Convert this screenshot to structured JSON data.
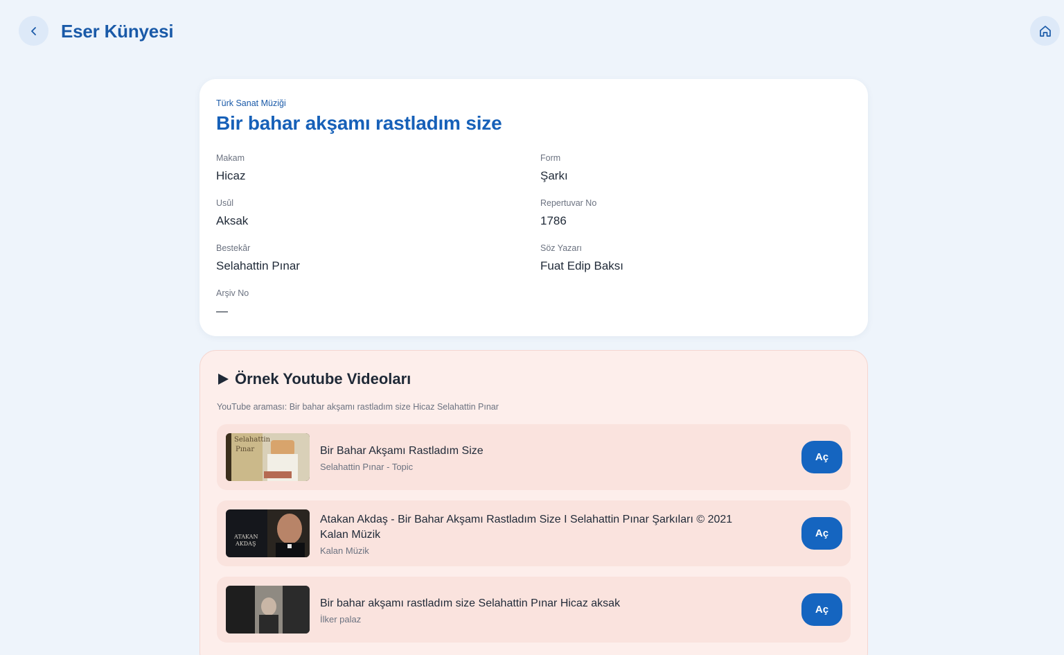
{
  "header": {
    "title": "Eser Künyesi",
    "back_icon": "chevron-left-icon",
    "home_icon": "home-icon"
  },
  "work": {
    "genre": "Türk Sanat Müziği",
    "title": "Bir bahar akşamı rastladım size",
    "fields": {
      "makam": {
        "label": "Makam",
        "value": "Hicaz"
      },
      "form": {
        "label": "Form",
        "value": "Şarkı"
      },
      "usul": {
        "label": "Usûl",
        "value": "Aksak"
      },
      "repertuvar": {
        "label": "Repertuvar No",
        "value": "1786"
      },
      "bestekar": {
        "label": "Bestekâr",
        "value": "Selahattin Pınar"
      },
      "soz_yazari": {
        "label": "Söz Yazarı",
        "value": "Fuat Edip Baksı"
      },
      "arsiv": {
        "label": "Arşiv No",
        "value": "—"
      }
    }
  },
  "videos": {
    "heading": "Örnek Youtube Videoları",
    "heading_icon": "play-triangle-icon",
    "query": "YouTube araması: Bir bahar akşamı rastladım size Hicaz Selahattin Pınar",
    "items": [
      {
        "title": "Bir Bahar Akşamı Rastladım Size",
        "channel": "Selahattin Pınar - Topic",
        "open_label": "Aç",
        "thumb_text": [
          "Selahattin",
          "Pınar"
        ]
      },
      {
        "title": "Atakan Akdaş - Bir Bahar Akşamı Rastladım Size I Selahattin Pınar Şarkıları © 2021 Kalan Müzik",
        "channel": "Kalan Müzik",
        "open_label": "Aç",
        "thumb_text": [
          "ATAKAN",
          "AKDAŞ"
        ]
      },
      {
        "title": "Bir bahar akşamı rastladım size Selahattin Pınar Hicaz aksak",
        "channel": "İlker palaz",
        "open_label": "Aç"
      }
    ]
  },
  "colors": {
    "accent": "#1565c0",
    "title_blue": "#1a5aa8",
    "background": "#eef4fb",
    "video_panel": "#fdeeeb",
    "video_item": "#fae3de"
  }
}
